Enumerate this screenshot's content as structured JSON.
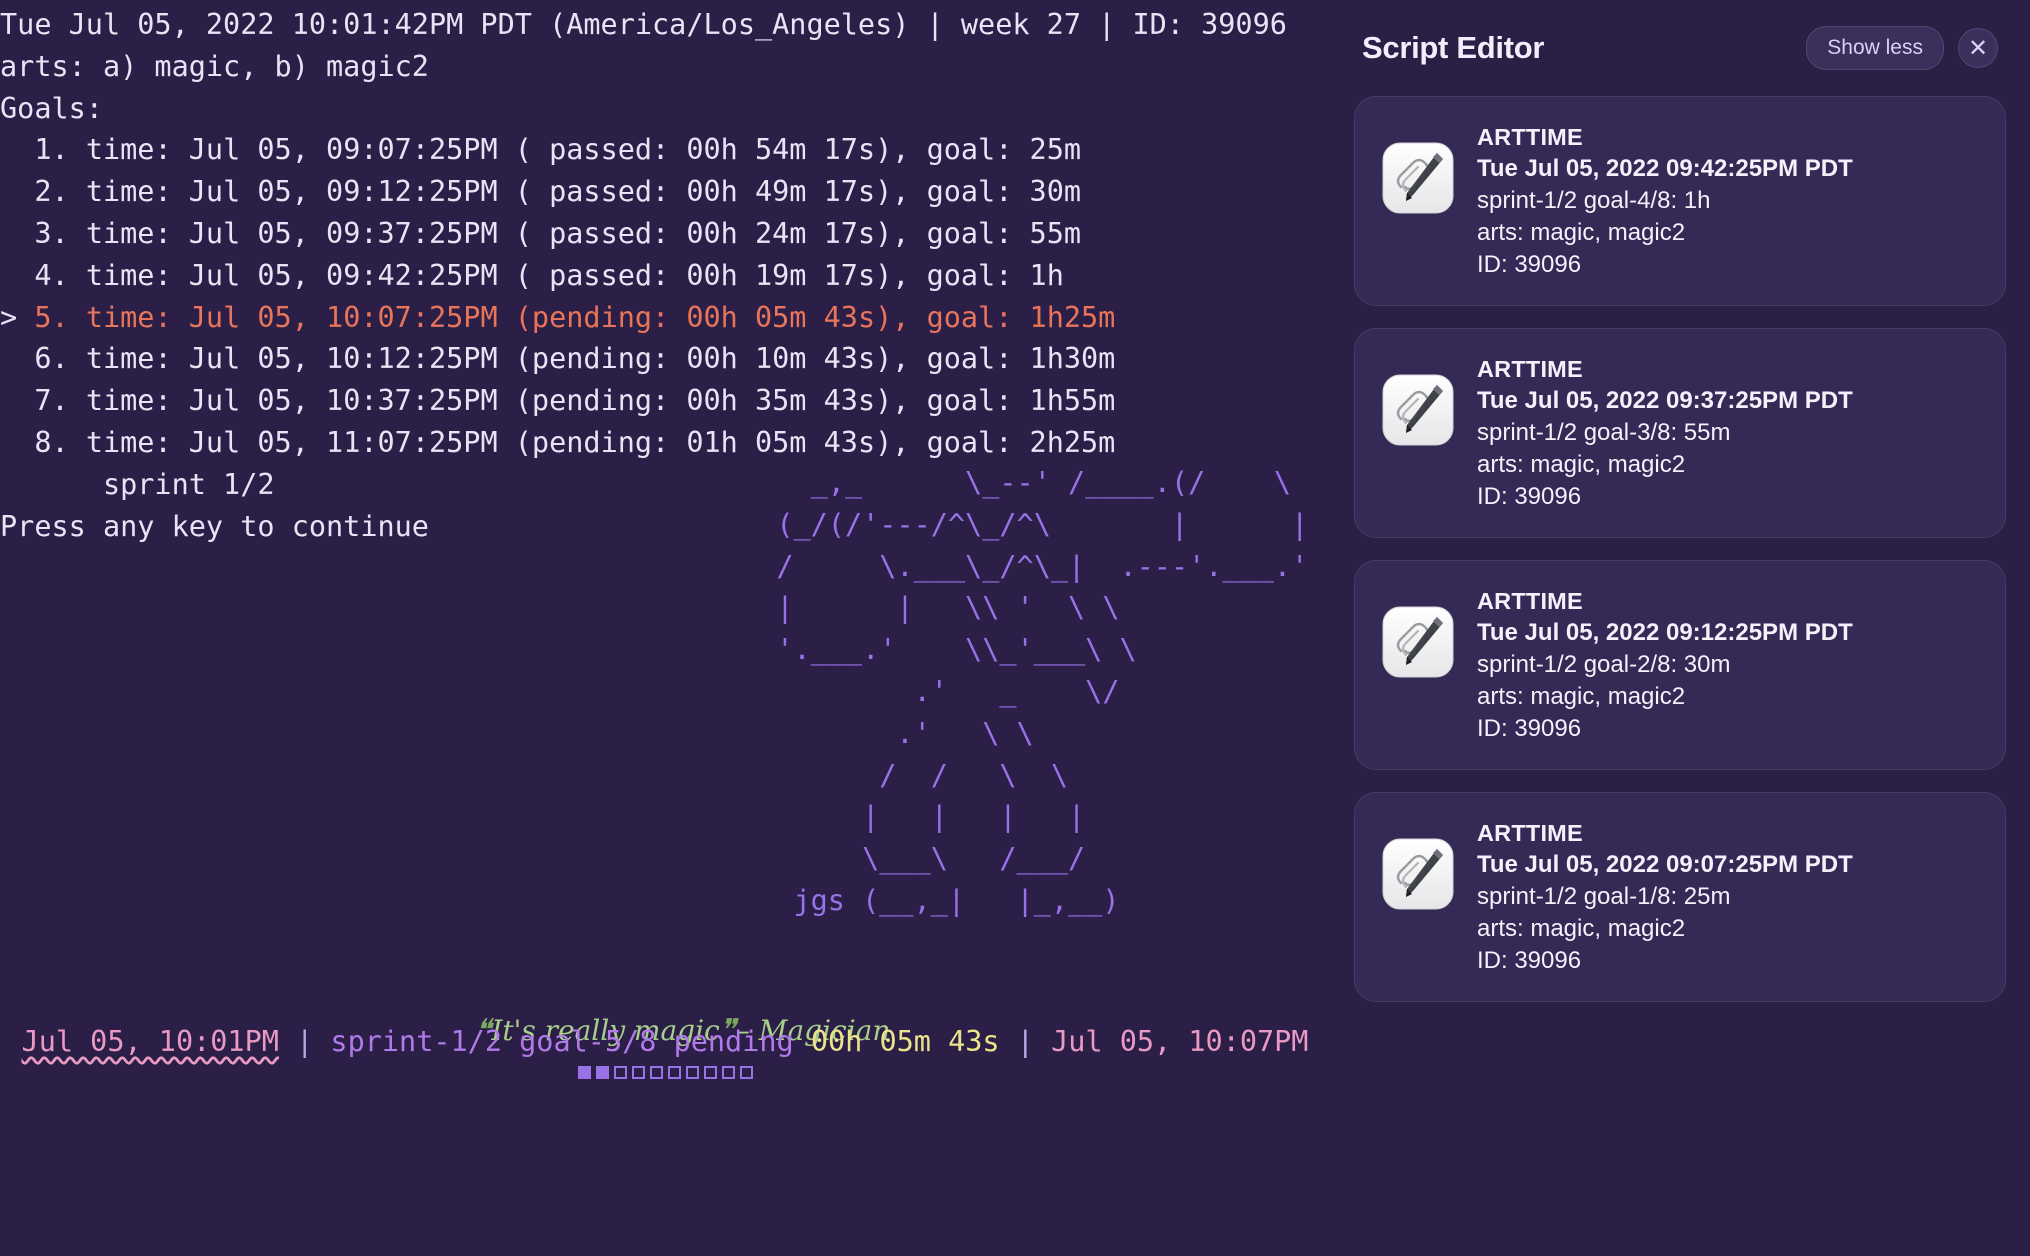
{
  "terminal": {
    "header": "Tue Jul 05, 2022 10:01:42PM PDT (America/Los_Angeles) | week 27 | ID: 39096",
    "arts_line": "arts: a) magic, b) magic2",
    "goals_label": "Goals:",
    "goals": [
      {
        "caret": "  ",
        "index": "1.",
        "text": " time: Jul 05, 09:07:25PM ( passed: 00h 54m 17s), goal: 25m",
        "state": "passed"
      },
      {
        "caret": "  ",
        "index": "2.",
        "text": " time: Jul 05, 09:12:25PM ( passed: 00h 49m 17s), goal: 30m",
        "state": "passed"
      },
      {
        "caret": "  ",
        "index": "3.",
        "text": " time: Jul 05, 09:37:25PM ( passed: 00h 24m 17s), goal: 55m",
        "state": "passed"
      },
      {
        "caret": "  ",
        "index": "4.",
        "text": " time: Jul 05, 09:42:25PM ( passed: 00h 19m 17s), goal: 1h",
        "state": "passed"
      },
      {
        "caret": "> ",
        "index": "5.",
        "text": " time: Jul 05, 10:07:25PM (pending: 00h 05m 43s), goal: 1h25m",
        "state": "current"
      },
      {
        "caret": "  ",
        "index": "6.",
        "text": " time: Jul 05, 10:12:25PM (pending: 00h 10m 43s), goal: 1h30m",
        "state": "pending"
      },
      {
        "caret": "  ",
        "index": "7.",
        "text": " time: Jul 05, 10:37:25PM (pending: 00h 35m 43s), goal: 1h55m",
        "state": "pending"
      },
      {
        "caret": "  ",
        "index": "8.",
        "text": " time: Jul 05, 11:07:25PM (pending: 01h 05m 43s), goal: 2h25m",
        "state": "pending"
      }
    ],
    "sprint_line": "      sprint 1/2",
    "prompt_line": "Press any key to continue",
    "ascii_art": "                \\_--' /____.(/    \\\n    _,_       \\_--' /____.(/    \\\n  (_/(/'---/^\\_/^\\        |      |\n  /     \\.___\\_/^\\_|  .---'.___.'\n  |      |   \\\\ '  \\ \\\n  '.___.'    \\\\_'___\\ \\\n        .'   _    \\/\n       /  .'  \\    \\ \\\n      /  /     \\    \\ \\\n     |   |     |    |\n     \\___\\    /___/\njgs (__,_|    |_,__)",
    "ascii_credit": "jgs",
    "quote": {
      "open_mark": "❝",
      "text": "It's really magic",
      "close_mark": "❞",
      "attribution": "– Magician"
    },
    "statusbar": {
      "time": "Jul 05, 10:01PM",
      "sep1": " | ",
      "sprint": "sprint-1/2 goal-5/8 pending ",
      "duration": "00h 05m 43s",
      "sep2": " | ",
      "next": "Jul 05, 10:07PM"
    },
    "progress": {
      "total": 10,
      "filled": 2
    }
  },
  "panel": {
    "title": "Script Editor",
    "show_less_label": "Show less",
    "close_label": "✕",
    "notifications": [
      {
        "app": "ARTTIME",
        "date": "Tue Jul 05, 2022 09:42:25PM PDT",
        "goal": "sprint-1/2 goal-4/8: 1h",
        "arts": "arts: magic, magic2",
        "id": "ID: 39096"
      },
      {
        "app": "ARTTIME",
        "date": "Tue Jul 05, 2022 09:37:25PM PDT",
        "goal": "sprint-1/2 goal-3/8: 55m",
        "arts": "arts: magic, magic2",
        "id": "ID: 39096"
      },
      {
        "app": "ARTTIME",
        "date": "Tue Jul 05, 2022 09:12:25PM PDT",
        "goal": "sprint-1/2 goal-2/8: 30m",
        "arts": "arts: magic, magic2",
        "id": "ID: 39096"
      },
      {
        "app": "ARTTIME",
        "date": "Tue Jul 05, 2022 09:07:25PM PDT",
        "goal": "sprint-1/2 goal-1/8: 25m",
        "arts": "arts: magic, magic2",
        "id": "ID: 39096"
      }
    ]
  },
  "colors": {
    "terminal_bg": "#2b1f47",
    "panel_bg": "#2a1f44",
    "card_bg": "#342a55",
    "text": "#e8e4f5",
    "current_goal": "#e8745a",
    "ascii_art": "#9a72e8",
    "quote": "#a8cf8a",
    "status_time": "#e89ac4",
    "status_sprint": "#b07ae8",
    "status_duration": "#ece48a"
  }
}
